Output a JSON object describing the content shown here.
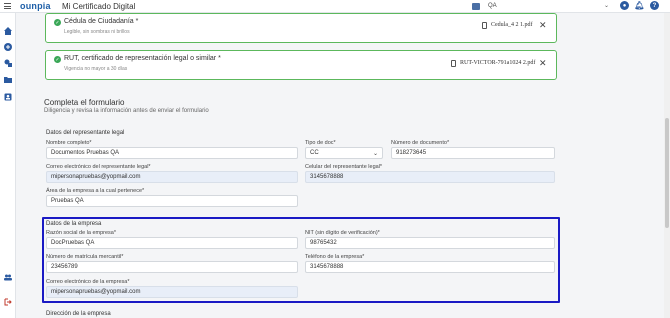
{
  "topbar": {
    "logo": "ounpia",
    "app_title": "Mi Certificado Digital",
    "environment": "QA",
    "icons": [
      "org-icon",
      "user-icon",
      "bell-icon",
      "help-icon"
    ]
  },
  "sidebar": {
    "icons": [
      "home-icon",
      "add-icon",
      "tools-icon",
      "folder-icon",
      "contact-card-icon",
      "users-icon",
      "logout-icon"
    ]
  },
  "files": [
    {
      "title": "Cédula de Ciudadanía *",
      "subtitle": "Legible, sin sombras ni brillos",
      "file_name": "Cedula_4 2 1.pdf"
    },
    {
      "title": "RUT, certificado de representación legal o similar *",
      "subtitle": "Vigencia no mayor a 30 días",
      "file_name": "RUT-VICTOR-791a1024 2.pdf"
    }
  ],
  "form": {
    "title": "Completa el formulario",
    "subtitle": "Diligencia y revisa la información antes de enviar el formulario",
    "legal_rep": {
      "title": "Datos del representante legal",
      "full_name_label": "Nombre completo*",
      "full_name_value": "Documentos Pruebas QA",
      "doc_type_label": "Tipo de doc*",
      "doc_type_value": "CC",
      "doc_number_label": "Número de documento*",
      "doc_number_value": "918273645",
      "email_label": "Correo electrónico del representante legal*",
      "email_value": "mipersonapruebas@yopmail.com",
      "phone_label": "Celular del representante legal*",
      "phone_value": "3145678888",
      "area_label": "Área de la empresa a la cual pertenece*",
      "area_value": "Pruebas QA"
    },
    "company": {
      "title": "Datos de la empresa",
      "name_label": "Razón social de la empresa*",
      "name_value": "DocPruebas QA",
      "nit_label": "NIT (sin dígito de verificación)*",
      "nit_value": "98765432",
      "registry_label": "Número de matrícula mercantil*",
      "registry_value": "23456789",
      "phone_label": "Teléfono de la empresa*",
      "phone_value": "3145678888",
      "email_label": "Correo electrónico de la empresa*",
      "email_value": "mipersonapruebas@yopmail.com"
    },
    "address_title": "Dirección de la empresa"
  },
  "colors": {
    "brand": "#1e5fa8",
    "success": "#3aa757",
    "highlight": "#1a1ac4"
  }
}
